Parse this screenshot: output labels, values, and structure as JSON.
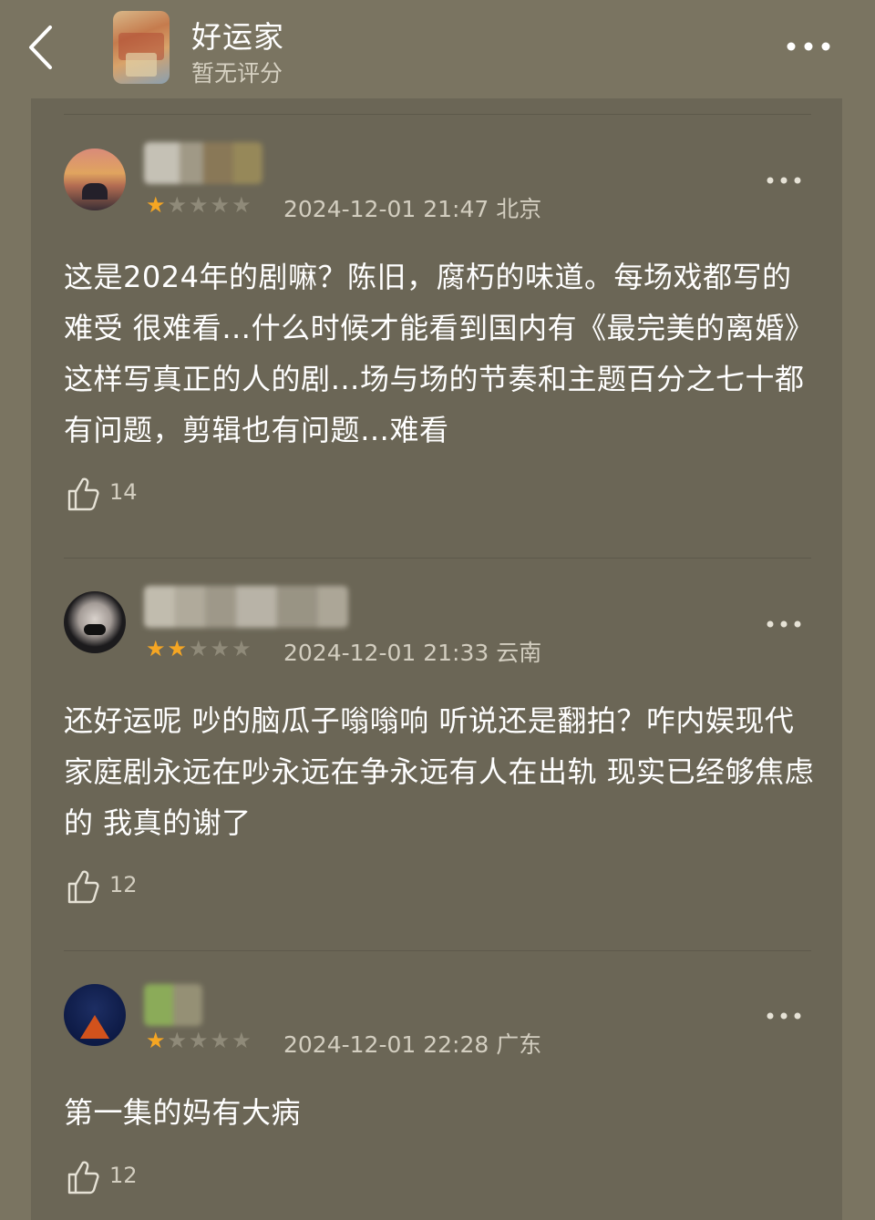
{
  "header": {
    "title": "好运家",
    "rating_text": "暂无评分"
  },
  "reviews": [
    {
      "rating": 1,
      "stars_on": "★",
      "stars_off": "★★★★",
      "date": "2024-12-01 21:47",
      "location": "北京",
      "text": "这是2024年的剧嘛？陈旧，腐朽的味道。每场戏都写的难受 很难看…什么时候才能看到国内有《最完美的离婚》这样写真正的人的剧…场与场的节奏和主题百分之七十都有问题，剪辑也有问题…难看",
      "likes": "14"
    },
    {
      "rating": 2,
      "stars_on": "★★",
      "stars_off": "★★★",
      "date": "2024-12-01 21:33",
      "location": "云南",
      "text": "还好运呢 吵的脑瓜子嗡嗡响 听说还是翻拍？咋内娱现代家庭剧永远在吵永远在争永远有人在出轨  现实已经够焦虑的 我真的谢了",
      "likes": "12"
    },
    {
      "rating": 1,
      "stars_on": "★",
      "stars_off": "★★★★",
      "date": "2024-12-01 22:28",
      "location": "广东",
      "text": "第一集的妈有大病",
      "likes": "12"
    }
  ],
  "colors": {
    "star_active": "#f5a623",
    "background": "#6b6656"
  }
}
